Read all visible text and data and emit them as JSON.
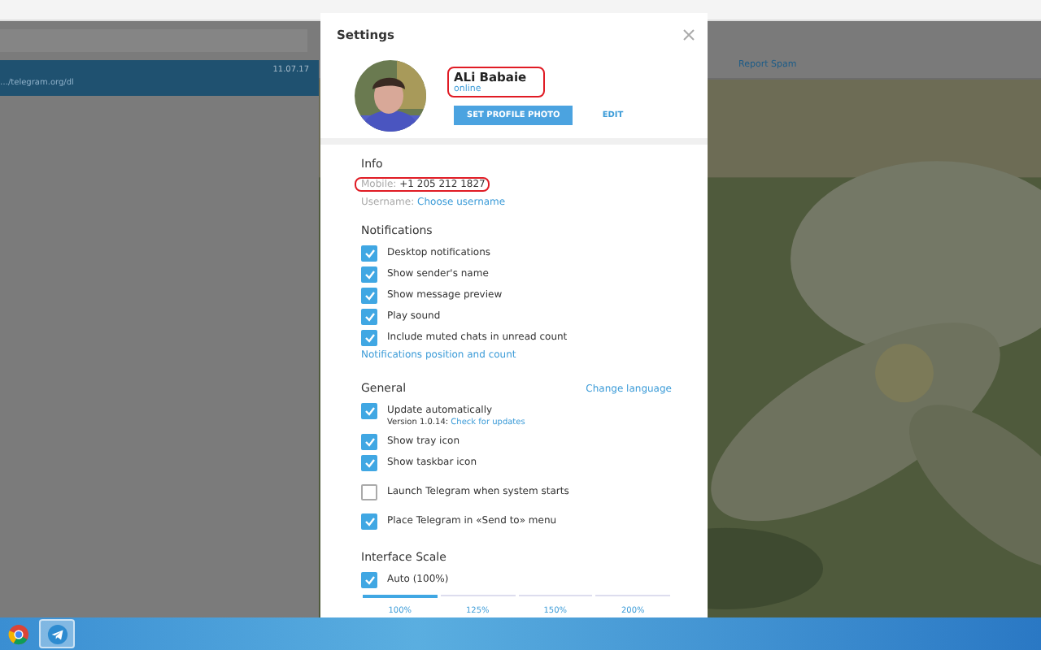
{
  "chat_list": {
    "selected_chat": {
      "preview": "…/telegram.org/dl",
      "time": "11.07.17"
    }
  },
  "chat_header": {
    "report_spam": "Report Spam"
  },
  "settings": {
    "title": "Settings",
    "profile": {
      "name": "ALi Babaie",
      "status": "online",
      "highlighted": true,
      "set_photo": "SET PROFILE PHOTO",
      "edit": "EDIT"
    },
    "info": {
      "heading": "Info",
      "mobile_label": "Mobile:",
      "mobile": "+1 205 212 1827",
      "highlighted": true,
      "username_label": "Username:",
      "username_link": "Choose username"
    },
    "notifications": {
      "heading": "Notifications",
      "options": [
        {
          "label": "Desktop notifications",
          "checked": true
        },
        {
          "label": "Show sender's name",
          "checked": true
        },
        {
          "label": "Show message preview",
          "checked": true
        },
        {
          "label": "Play sound",
          "checked": true
        },
        {
          "label": "Include muted chats in unread count",
          "checked": true
        }
      ],
      "link": "Notifications position and count"
    },
    "general": {
      "heading": "General",
      "change_language": "Change language",
      "groups": [
        [
          {
            "label": "Update automatically",
            "checked": true,
            "note": "Version 1.0.14:",
            "note_link": "Check for updates"
          },
          {
            "label": "Show tray icon",
            "checked": true
          },
          {
            "label": "Show taskbar icon",
            "checked": true
          }
        ],
        [
          {
            "label": "Launch Telegram when system starts",
            "checked": false
          }
        ],
        [
          {
            "label": "Place Telegram in «Send to» menu",
            "checked": true
          }
        ]
      ]
    },
    "interface_scale": {
      "heading": "Interface Scale",
      "auto": {
        "label": "Auto (100%)",
        "checked": true
      },
      "scales": [
        {
          "label": "100%",
          "selected": true
        },
        {
          "label": "125%",
          "selected": false
        },
        {
          "label": "150%",
          "selected": false
        },
        {
          "label": "200%",
          "selected": false
        }
      ]
    }
  },
  "taskbar": {
    "apps": [
      {
        "kind": "chrome",
        "selected": false
      },
      {
        "kind": "telegram",
        "selected": true
      }
    ]
  }
}
